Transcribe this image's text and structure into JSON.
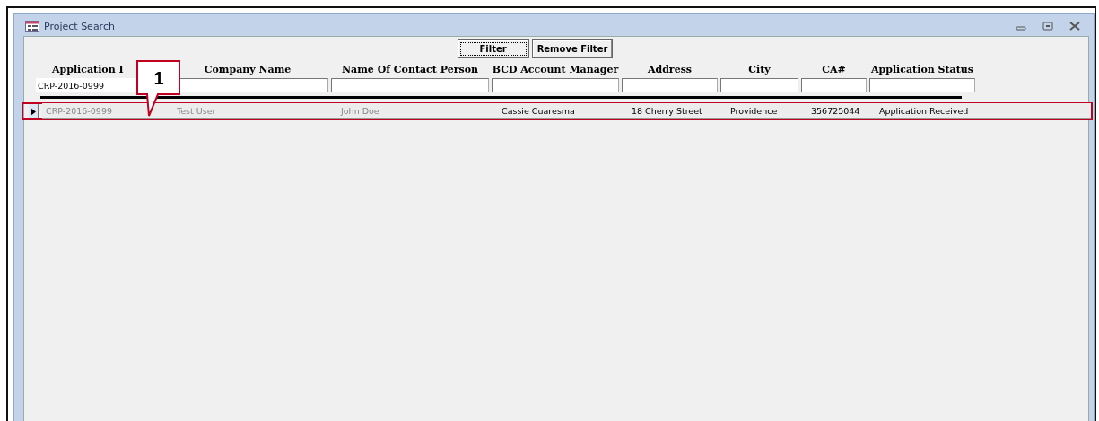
{
  "window": {
    "title": "Project Search"
  },
  "buttons": [
    {
      "label": "Filter",
      "focused": true
    },
    {
      "label": "Remove Filter",
      "focused": false
    }
  ],
  "columns": [
    {
      "label": "Application I",
      "filter": "CRP-2016-0999"
    },
    {
      "label": "Company Name"
    },
    {
      "label": "Name Of Contact Person"
    },
    {
      "label": "BCD Account Manager"
    },
    {
      "label": "Address"
    },
    {
      "label": "City"
    },
    {
      "label": "CA#"
    },
    {
      "label": "Application Status"
    }
  ],
  "rows": [
    {
      "selected": true,
      "highlighted": true,
      "cells": [
        {
          "text": "CRP-2016-0999",
          "dimmed": true
        },
        {
          "text": "Test User",
          "dimmed": true
        },
        {
          "text": "John Doe",
          "dimmed": true
        },
        {
          "text": "Cassie Cuaresma",
          "dimmed": false
        },
        {
          "text": "18 Cherry Street",
          "dimmed": false
        },
        {
          "text": "Providence",
          "dimmed": false
        },
        {
          "text": "356725044",
          "dimmed": false
        },
        {
          "text": "Application Received",
          "dimmed": false
        }
      ]
    }
  ],
  "callout": {
    "label": "1"
  }
}
